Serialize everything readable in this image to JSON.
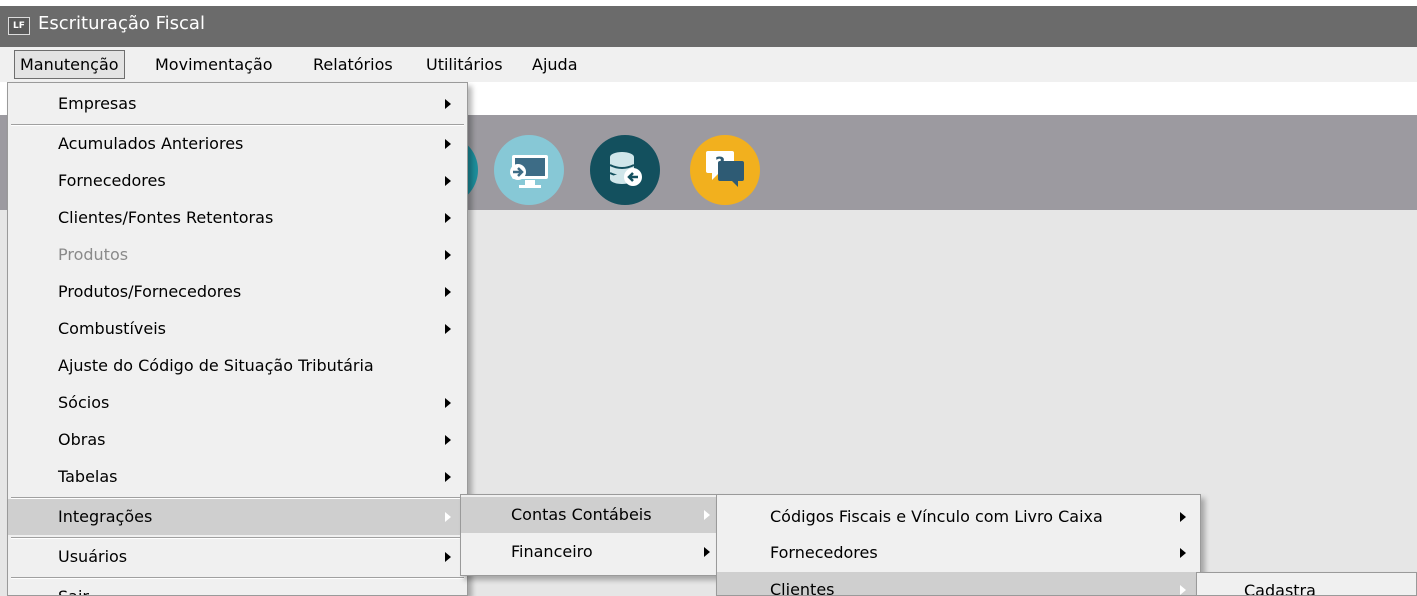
{
  "window": {
    "icon_text": "LF",
    "title": "Escrituração Fiscal"
  },
  "menubar": {
    "items": [
      {
        "label": "Manutenção"
      },
      {
        "label": "Movimentação"
      },
      {
        "label": "Relatórios"
      },
      {
        "label": "Utilitários"
      },
      {
        "label": "Ajuda"
      }
    ]
  },
  "toolbar": {
    "buttons": [
      {
        "icon": "partial-teal-icon",
        "color": "#1c8d9b"
      },
      {
        "icon": "monitor-arrow-icon",
        "color": "#87c8d6"
      },
      {
        "icon": "database-arrow-icon",
        "color": "#13505e"
      },
      {
        "icon": "help-chat-icon",
        "color": "#f2b01e",
        "glyph": "?"
      }
    ]
  },
  "menus": {
    "manutencao": {
      "items": [
        {
          "label": "Empresas",
          "submenu": true
        },
        {
          "label": "Acumulados Anteriores",
          "submenu": true
        },
        {
          "label": "Fornecedores",
          "submenu": true
        },
        {
          "label": "Clientes/Fontes Retentoras",
          "submenu": true
        },
        {
          "label": "Produtos",
          "submenu": true,
          "disabled": true
        },
        {
          "label": "Produtos/Fornecedores",
          "submenu": true
        },
        {
          "label": "Combustíveis",
          "submenu": true
        },
        {
          "label": "Ajuste do Código de Situação Tributária",
          "submenu": false
        },
        {
          "label": "Sócios",
          "submenu": true
        },
        {
          "label": "Obras",
          "submenu": true
        },
        {
          "label": "Tabelas",
          "submenu": true
        },
        {
          "label": "Integrações",
          "submenu": true,
          "highlighted": true
        },
        {
          "label": "Usuários",
          "submenu": true
        },
        {
          "label": "Sair",
          "submenu": false
        }
      ]
    },
    "integracoes": {
      "items": [
        {
          "label": "Contas Contábeis",
          "submenu": true,
          "highlighted": true
        },
        {
          "label": "Financeiro",
          "submenu": true
        }
      ]
    },
    "contas_contabeis": {
      "items": [
        {
          "label": "Códigos Fiscais e Vínculo com Livro Caixa",
          "submenu": true
        },
        {
          "label": "Fornecedores",
          "submenu": true
        },
        {
          "label": "Clientes",
          "submenu": true,
          "highlighted": true
        }
      ]
    },
    "clientes": {
      "items": [
        {
          "label": "Cadastra"
        }
      ]
    }
  },
  "colors": {
    "titlebar": "#6b6b6b",
    "menu_bg": "#f0f0f0",
    "toolbar_bg": "#9c9aa0",
    "workspace_bg": "#e6e6e6",
    "highlight": "#cfcfcf"
  }
}
